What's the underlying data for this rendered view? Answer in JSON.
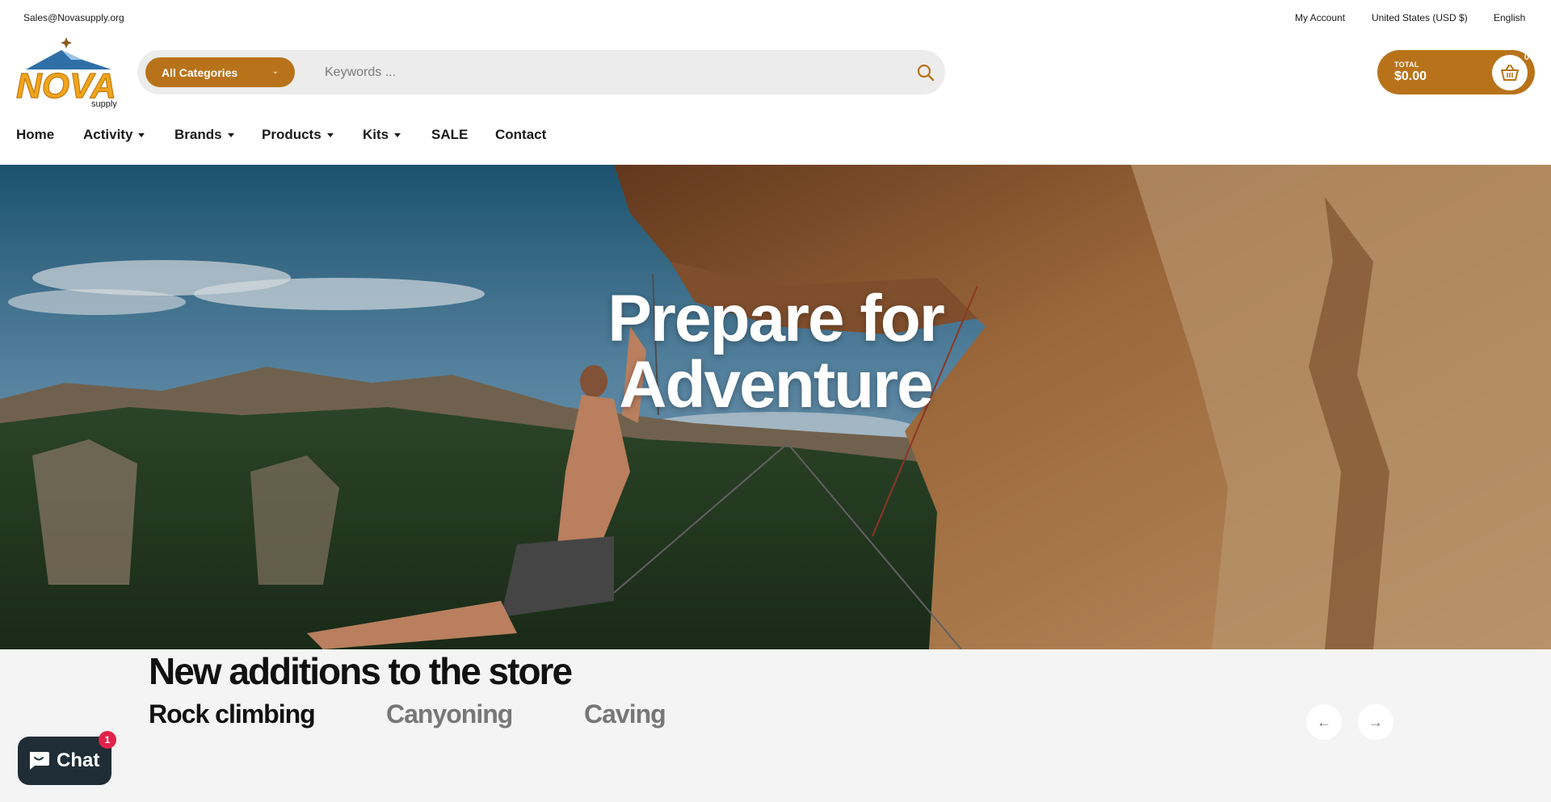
{
  "topbar": {
    "email": "Sales@Novasupply.org",
    "account": "My Account",
    "currency": "United States (USD $)",
    "language": "English"
  },
  "logo": {
    "brand": "NOVA",
    "sub": "supply"
  },
  "search": {
    "category_label": "All Categories",
    "placeholder": "Keywords ..."
  },
  "cart": {
    "total_label": "TOTAL",
    "total_value": "$0.00",
    "count": "0"
  },
  "nav": {
    "items": [
      {
        "label": "Home",
        "dropdown": false
      },
      {
        "label": "Activity",
        "dropdown": true
      },
      {
        "label": "Brands",
        "dropdown": true
      },
      {
        "label": "Products",
        "dropdown": true
      },
      {
        "label": "Kits",
        "dropdown": true
      },
      {
        "label": "SALE",
        "dropdown": false
      },
      {
        "label": "Contact",
        "dropdown": false
      }
    ]
  },
  "hero": {
    "line1": "Prepare for",
    "line2": "Adventure"
  },
  "additions": {
    "title": "New additions to the store",
    "tabs": [
      "Rock climbing",
      "Canyoning",
      "Caving"
    ],
    "active_tab": "Rock climbing"
  },
  "chat": {
    "label": "Chat",
    "badge": "1"
  },
  "colors": {
    "accent": "#b8731a",
    "chat_bg": "#1f2d36",
    "badge": "#e0234b"
  }
}
